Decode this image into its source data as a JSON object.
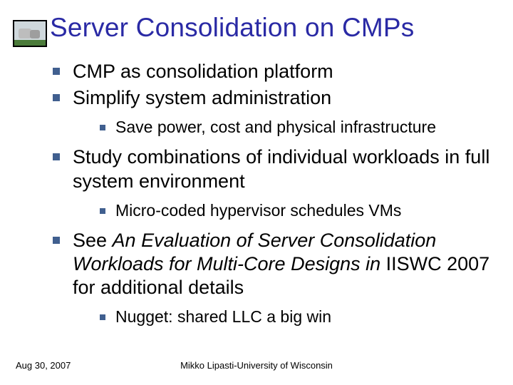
{
  "title": "Server Consolidation on CMPs",
  "bullets": {
    "b1": "CMP as consolidation platform",
    "b2": "Simplify system administration",
    "b2_sub1": "Save power, cost and physical infrastructure",
    "b3": "Study combinations of individual workloads in full system environment",
    "b3_sub1": "Micro-coded hypervisor schedules VMs",
    "b4_pre": "See ",
    "b4_italic": "An Evaluation of Server Consolidation Workloads for Multi-Core Designs in",
    "b4_post": " IISWC 2007 for additional details",
    "b4_sub1": "Nugget: shared LLC a big win"
  },
  "footer": {
    "date": "Aug 30, 2007",
    "attribution": "Mikko Lipasti-University of Wisconsin"
  }
}
